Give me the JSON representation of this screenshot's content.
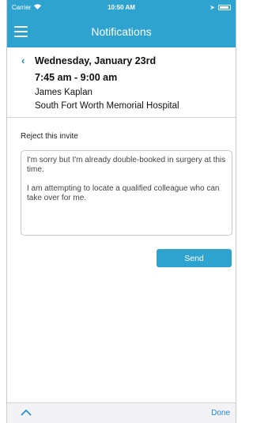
{
  "status_bar": {
    "carrier": "Carrier",
    "wifi_icon": "wifi-icon",
    "time": "10:50 AM",
    "battery_icon": "battery-icon"
  },
  "nav": {
    "title": "Notifications",
    "menu_icon": "hamburger-menu-icon"
  },
  "event": {
    "back_icon": "chevron-left-icon",
    "date": "Wednesday, January 23rd",
    "time_range": "7:45 am - 9:00 am",
    "person": "James Kaplan",
    "location": "South Fort Worth Memorial Hospital"
  },
  "reject": {
    "label": "Reject this invite",
    "message_line_1": "I'm sorry but I'm already double-booked in surgery at this time.",
    "message_line_2": "I am attempting to locate a qualified colleague who can take over for me.",
    "send_label": "Send"
  },
  "keyboard_toolbar": {
    "up_icon": "chevron-up-icon",
    "done_label": "Done"
  },
  "colors": {
    "header": "#2fa3cf",
    "accent": "#1e88d9"
  }
}
